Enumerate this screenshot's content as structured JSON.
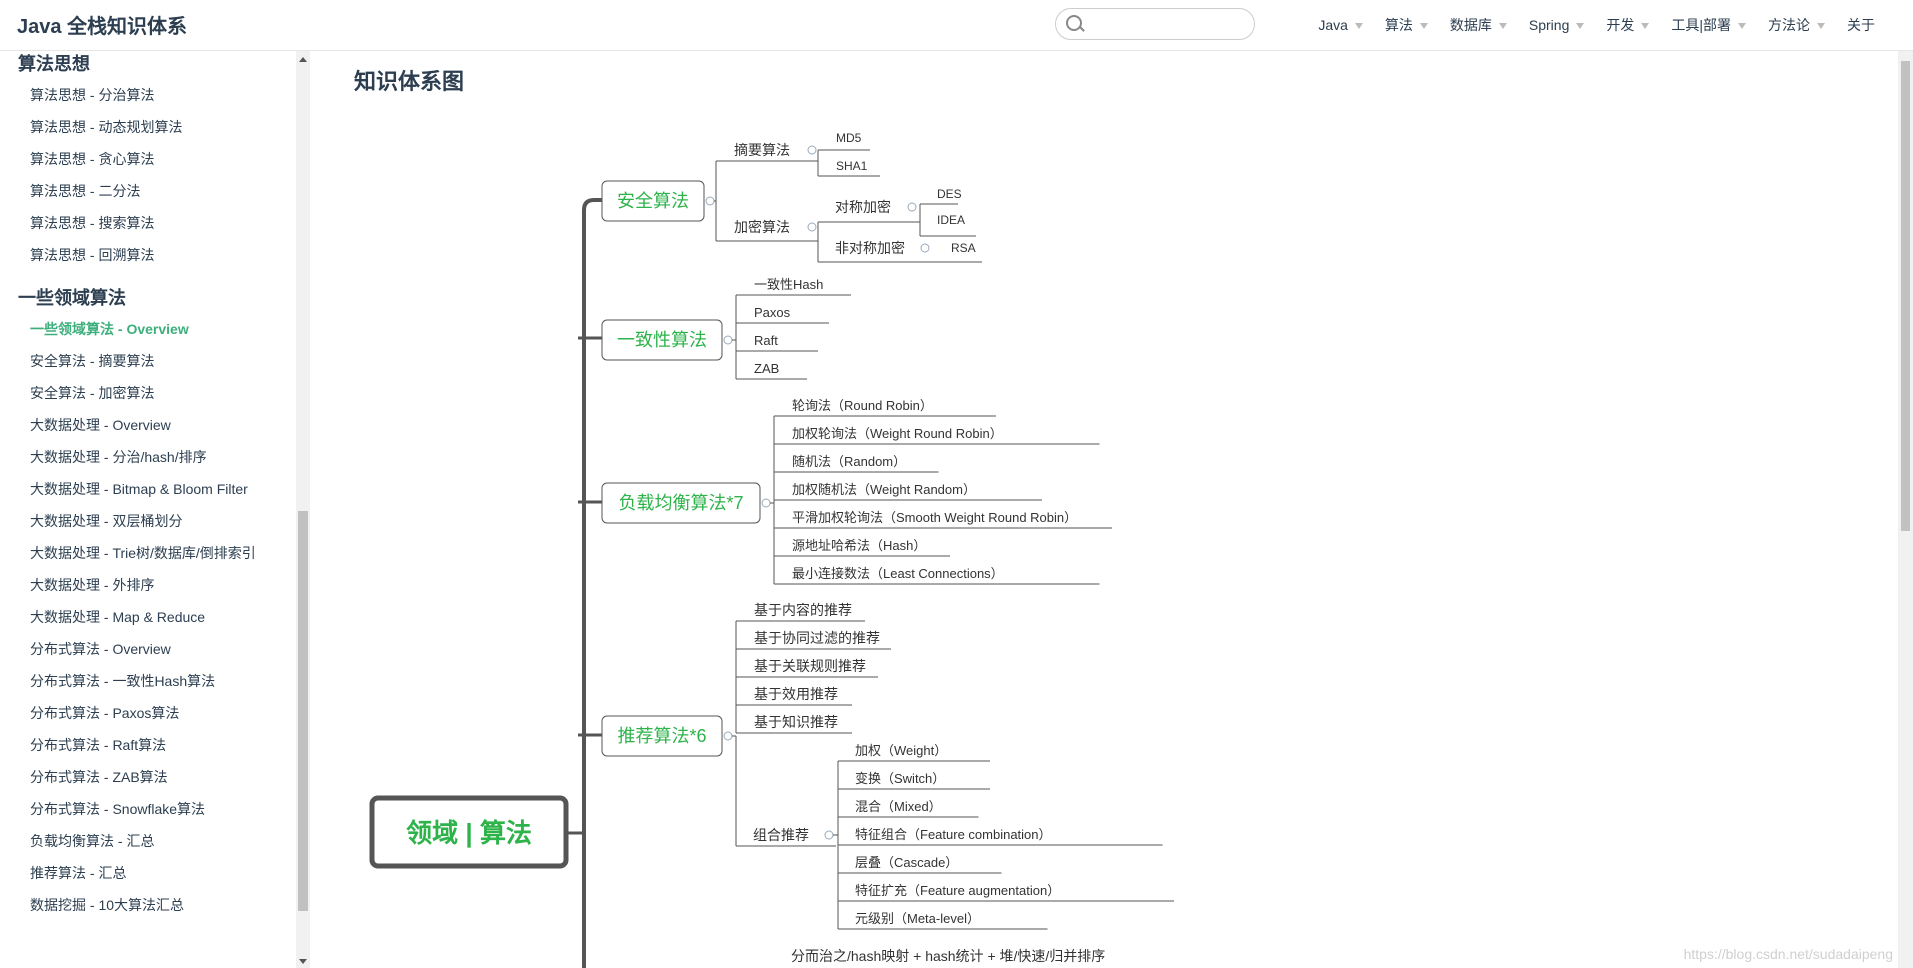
{
  "header": {
    "brand": "Java 全栈知识体系",
    "search_placeholder": "",
    "nav": [
      {
        "label": "Java",
        "has_dropdown": true
      },
      {
        "label": "算法",
        "has_dropdown": true
      },
      {
        "label": "数据库",
        "has_dropdown": true
      },
      {
        "label": "Spring",
        "has_dropdown": true
      },
      {
        "label": "开发",
        "has_dropdown": true
      },
      {
        "label": "工具|部署",
        "has_dropdown": true
      },
      {
        "label": "方法论",
        "has_dropdown": true
      },
      {
        "label": "关于",
        "has_dropdown": false
      }
    ]
  },
  "sidebar": {
    "groups": [
      {
        "title": "算法思想",
        "items": [
          {
            "label": "算法思想 - 分治算法"
          },
          {
            "label": "算法思想 - 动态规划算法"
          },
          {
            "label": "算法思想 - 贪心算法"
          },
          {
            "label": "算法思想 - 二分法"
          },
          {
            "label": "算法思想 - 搜索算法"
          },
          {
            "label": "算法思想 - 回溯算法"
          }
        ]
      },
      {
        "title": "一些领域算法",
        "items": [
          {
            "label": "一些领域算法 - Overview",
            "active": true
          },
          {
            "label": "安全算法 - 摘要算法"
          },
          {
            "label": "安全算法 - 加密算法"
          },
          {
            "label": "大数据处理 - Overview"
          },
          {
            "label": "大数据处理 - 分治/hash/排序"
          },
          {
            "label": "大数据处理 - Bitmap & Bloom Filter"
          },
          {
            "label": "大数据处理 - 双层桶划分"
          },
          {
            "label": "大数据处理 - Trie树/数据库/倒排索引"
          },
          {
            "label": "大数据处理 - 外排序"
          },
          {
            "label": "大数据处理 - Map & Reduce"
          },
          {
            "label": "分布式算法 - Overview"
          },
          {
            "label": "分布式算法 - 一致性Hash算法"
          },
          {
            "label": "分布式算法 - Paxos算法"
          },
          {
            "label": "分布式算法 - Raft算法"
          },
          {
            "label": "分布式算法 - ZAB算法"
          },
          {
            "label": "分布式算法 - Snowflake算法"
          },
          {
            "label": "负载均衡算法 - 汇总"
          },
          {
            "label": "推荐算法 - 汇总"
          },
          {
            "label": "数据挖掘 - 10大算法汇总"
          }
        ]
      }
    ]
  },
  "main": {
    "title": "知识体系图",
    "watermark": "https://blog.csdn.net/sudadaipeng",
    "mindmap": {
      "root": "领域 | 算法",
      "colors": {
        "branch": "#2db34a",
        "line": "#555555",
        "root_border": "#555555"
      },
      "branches": {
        "security": {
          "label": "安全算法",
          "digest": {
            "label": "摘要算法",
            "items": [
              "MD5",
              "SHA1"
            ]
          },
          "encrypt": {
            "label": "加密算法",
            "symmetric": {
              "label": "对称加密",
              "items": [
                "DES",
                "IDEA"
              ]
            },
            "asymmetric": {
              "label": "非对称加密",
              "items": [
                "RSA"
              ]
            }
          }
        },
        "consistency": {
          "label": "一致性算法",
          "items": [
            "一致性Hash",
            "Paxos",
            "Raft",
            "ZAB"
          ]
        },
        "load_balance": {
          "label": "负载均衡算法*7",
          "items": [
            "轮询法（Round Robin）",
            "加权轮询法（Weight Round Robin）",
            "随机法（Random）",
            "加权随机法（Weight Random）",
            "平滑加权轮询法（Smooth Weight Round Robin）",
            "源地址哈希法（Hash）",
            "最小连接数法（Least Connections）"
          ]
        },
        "recommend": {
          "label": "推荐算法*6",
          "items": [
            "基于内容的推荐",
            "基于协同过滤的推荐",
            "基于关联规则推荐",
            "基于效用推荐",
            "基于知识推荐"
          ],
          "hybrid": {
            "label": "组合推荐",
            "items": [
              "加权（Weight）",
              "变换（Switch）",
              "混合（Mixed）",
              "特征组合（Feature combination）",
              "层叠（Cascade）",
              "特征扩充（Feature augmentation）",
              "元级别（Meta-level）"
            ]
          }
        },
        "bigdata_first": "分而治之/hash映射 + hash统计 + 堆/快速/归并排序"
      }
    }
  }
}
